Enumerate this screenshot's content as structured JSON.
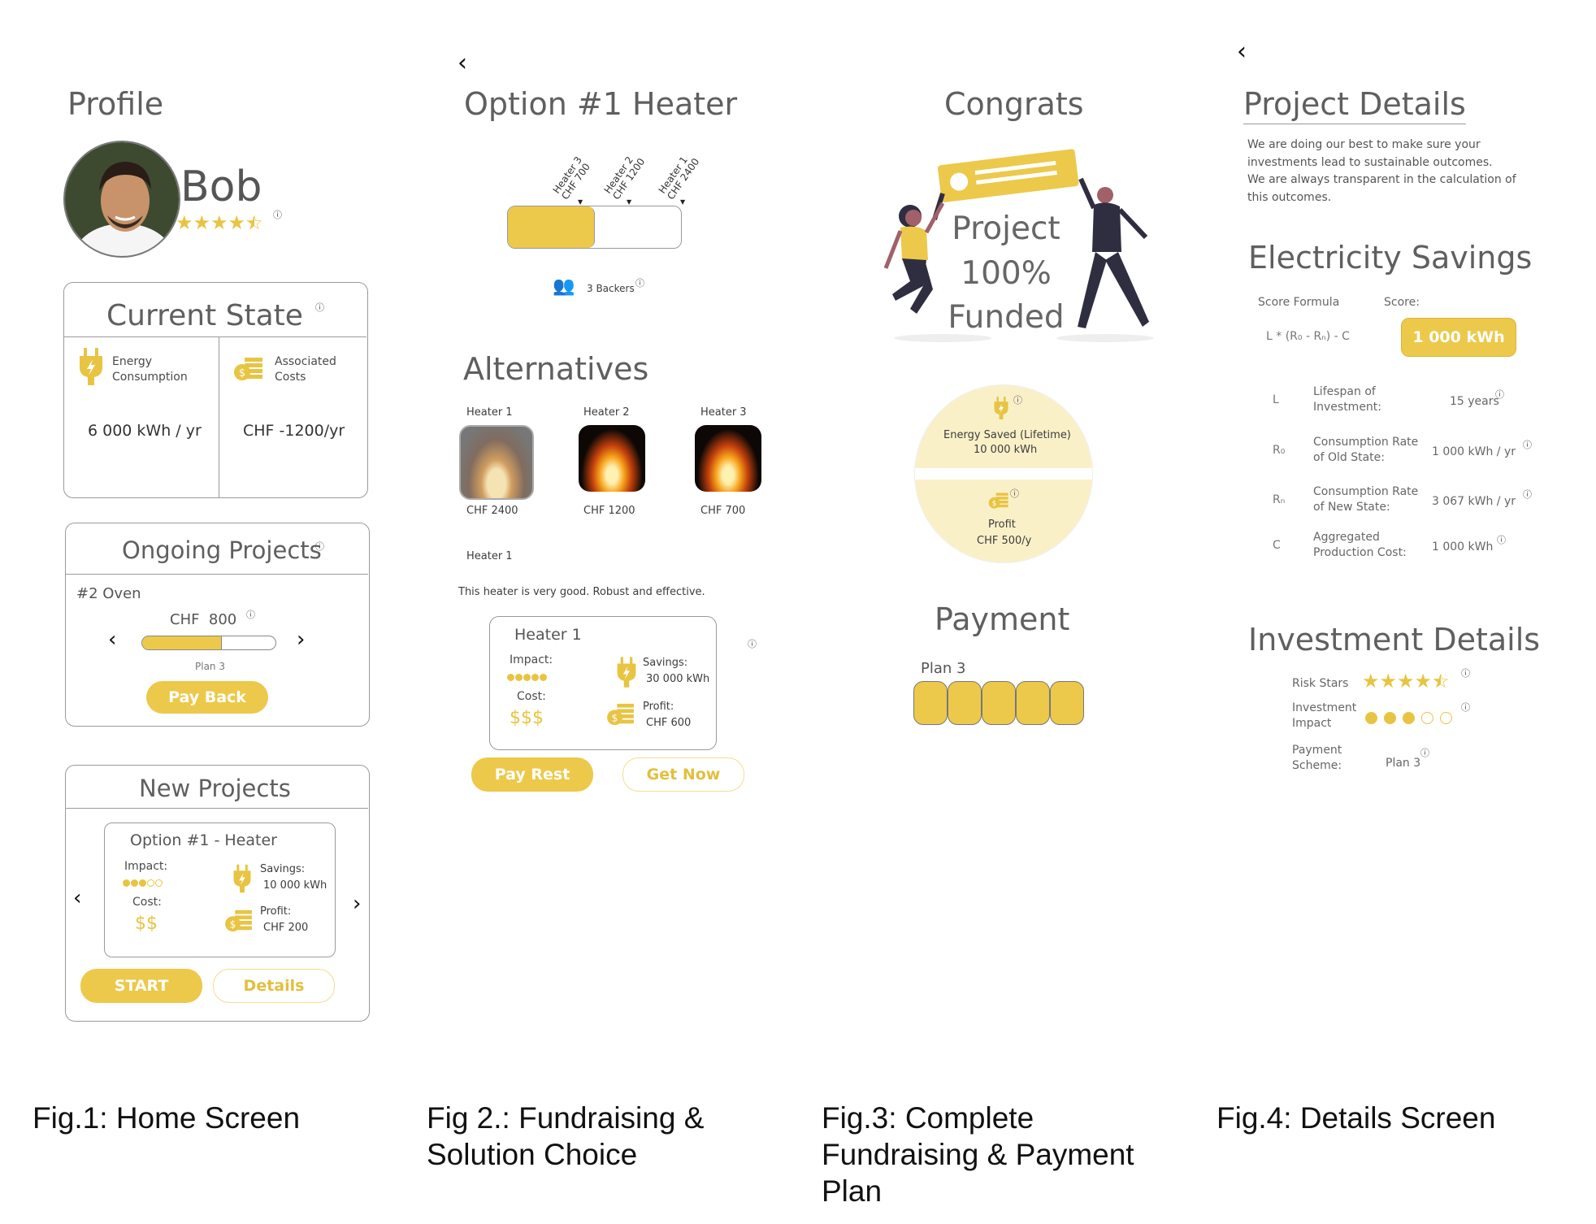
{
  "home": {
    "title": "Profile",
    "user_name": "Bob",
    "user_rating": 4.5,
    "current_state": {
      "title": "Current State",
      "energy_label": "Energy\nConsumption",
      "energy_value": "6 000 kWh / yr",
      "costs_label": "Associated\nCosts",
      "costs_value": "CHF -1200/yr"
    },
    "ongoing": {
      "title": "Ongoing Projects",
      "project": "#2 Oven",
      "amount": "CHF  800",
      "progress": 0.6,
      "plan": "Plan 3",
      "pay_back": "Pay Back"
    },
    "new_projects": {
      "title": "New Projects",
      "card_title": "Option #1 - Heater",
      "impact_label": "Impact:",
      "impact_level": 3,
      "savings_label": "Savings:",
      "savings_value": "10 000 kWh",
      "cost_label": "Cost:",
      "cost_value": "$$",
      "profit_label": "Profit:",
      "profit_value": "CHF 200",
      "start": "START",
      "details": "Details"
    },
    "caption": "Fig.1: Home Screen"
  },
  "fundraising": {
    "title": "Option #1 Heater",
    "markers": [
      {
        "name": "Heater 3",
        "price": "CHF 700"
      },
      {
        "name": "Heater 2",
        "price": "CHF 1200"
      },
      {
        "name": "Heater 1",
        "price": "CHF 2400"
      }
    ],
    "progress": 0.5,
    "backers": "3 Backers",
    "alternatives_title": "Alternatives",
    "alternatives": [
      {
        "name": "Heater 1",
        "price": "CHF 2400"
      },
      {
        "name": "Heater 2",
        "price": "CHF 1200"
      },
      {
        "name": "Heater 3",
        "price": "CHF 700"
      }
    ],
    "selected_name": "Heater 1",
    "description": "This heater is very good. Robust and effective.",
    "card": {
      "title": "Heater 1",
      "impact_label": "Impact:",
      "impact_level": 5,
      "savings_label": "Savings:",
      "savings_value": "30 000 kWh",
      "cost_label": "Cost:",
      "cost_value": "$$$",
      "profit_label": "Profit:",
      "profit_value": "CHF 600"
    },
    "pay_rest": "Pay Rest",
    "get_now": "Get Now",
    "caption": "Fig 2.: Fundraising &\nSolution Choice"
  },
  "congrats": {
    "title": "Congrats",
    "funded_text": "Project\n100%\nFunded",
    "energy_saved_label": "Energy Saved (Lifetime)",
    "energy_saved_value": "10 000 kWh",
    "profit_label": "Profit",
    "profit_value": "CHF 500/y",
    "payment_title": "Payment",
    "plan": "Plan 3",
    "plan_segments": 5,
    "caption": "Fig.3: Complete\nFundraising & Payment\nPlan"
  },
  "details": {
    "title": "Project Details",
    "intro": "We are doing our best to make sure your\ninvestments lead to sustainable outcomes.\nWe are always transparent in the calculation of\nthis outcomes.",
    "electricity_title": "Electricity Savings",
    "score_formula_label": "Score Formula",
    "score_label": "Score:",
    "formula": "L * (R₀ - Rₙ) - C",
    "score_value": "1 000 kWh",
    "rows": [
      {
        "sym": "L",
        "label": "Lifespan of\nInvestment:",
        "value": "15 years"
      },
      {
        "sym": "R₀",
        "label": "Consumption Rate\nof Old State:",
        "value": "1 000 kWh / yr"
      },
      {
        "sym": "Rₙ",
        "label": "Consumption Rate\nof New State:",
        "value": "3 067 kWh / yr"
      },
      {
        "sym": "C",
        "label": "Aggregated\nProduction Cost:",
        "value": "1 000 kWh"
      }
    ],
    "investment_title": "Investment Details",
    "risk_label": "Risk Stars",
    "risk_rating": 4.5,
    "impact_label": "Investment\nImpact",
    "impact_level": 3,
    "scheme_label": "Payment\nScheme:",
    "scheme_value": "Plan 3",
    "caption": "Fig.4: Details Screen"
  },
  "colors": {
    "accent": "#ecc94b",
    "light_accent": "#faf0c8",
    "border": "#9a9a9a"
  },
  "icons": [
    "back-chevron-icon",
    "info-icon",
    "plug-icon",
    "coins-icon",
    "users-icon",
    "star-icon",
    "flame-image"
  ]
}
